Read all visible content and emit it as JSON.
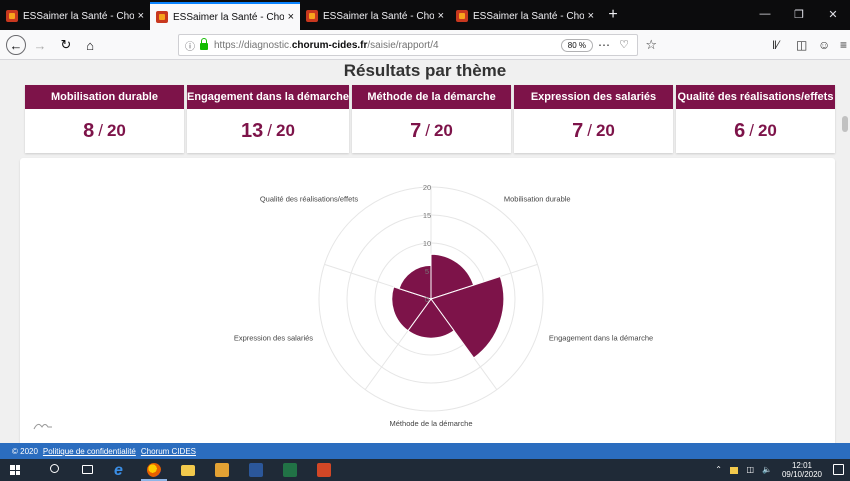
{
  "browser": {
    "tabs": [
      {
        "title": "ESSaimer la Santé - Chorum",
        "active": false
      },
      {
        "title": "ESSaimer la Santé - Chorum",
        "active": true
      },
      {
        "title": "ESSaimer la Santé - Chorum",
        "active": false
      },
      {
        "title": "ESSaimer la Santé - Chorum",
        "active": false
      }
    ],
    "close_glyph": "×",
    "new_tab_glyph": "+",
    "url": {
      "scheme": "https://diagnostic.",
      "domain": "chorum-cides.fr",
      "path": "/saisie/rapport/4"
    },
    "zoom": "80 %"
  },
  "page": {
    "title": "Résultats par thème",
    "score_separator": "/",
    "themes": [
      {
        "name": "Mobilisation durable",
        "score": "8",
        "max": "20"
      },
      {
        "name": "Engagement dans la démarche",
        "score": "13",
        "max": "20"
      },
      {
        "name": "Méthode de la démarche",
        "score": "7",
        "max": "20"
      },
      {
        "name": "Expression des salariés",
        "score": "7",
        "max": "20"
      },
      {
        "name": "Qualité des réalisations/effets",
        "score": "6",
        "max": "20"
      }
    ]
  },
  "chart_data": {
    "type": "polar-area",
    "title": "",
    "categories": [
      "Mobilisation durable",
      "Engagement dans la démarche",
      "Méthode de la démarche",
      "Expression des salariés",
      "Qualité des réalisations/effets"
    ],
    "values": [
      8,
      13,
      7,
      7,
      6
    ],
    "r_ticks": [
      "0",
      "5",
      "10",
      "15",
      "20"
    ],
    "r_range": [
      0,
      20
    ],
    "color": "#7d1349",
    "grid": true,
    "legend": "none"
  },
  "footer": {
    "copyright": "© 2020",
    "privacy_link": "Politique de confidentialité",
    "org_link": "Chorum CIDES"
  },
  "taskbar": {
    "time": "12:01",
    "date": "09/10/2020"
  },
  "colors": {
    "brand": "#7d1349",
    "footer": "#2b6dbf",
    "taskbar": "#1f2a37"
  }
}
